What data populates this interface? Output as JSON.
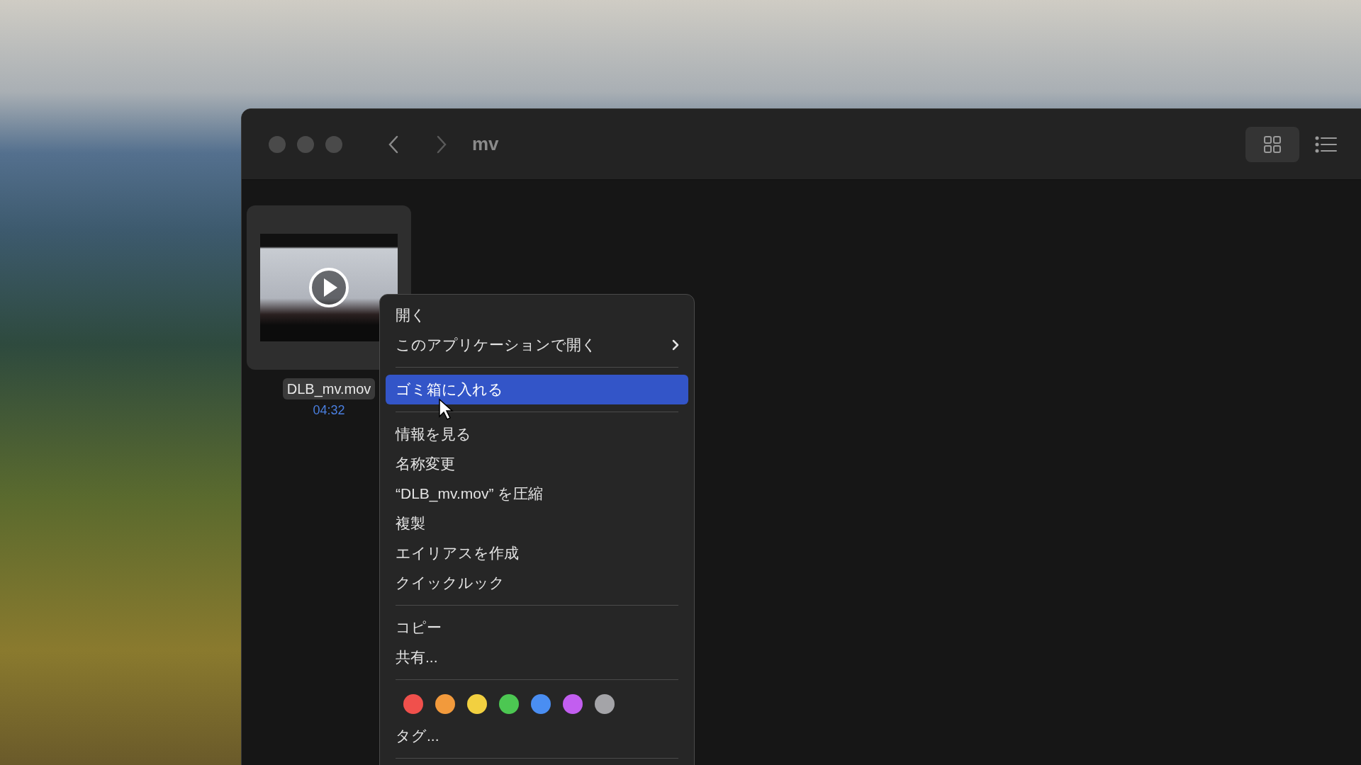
{
  "window": {
    "title": "mv",
    "view_buttons": [
      {
        "kind": "grid",
        "selected": true
      },
      {
        "kind": "list",
        "selected": false
      }
    ]
  },
  "file": {
    "name": "DLB_mv.mov",
    "duration": "04:32",
    "selected": true
  },
  "menu": {
    "items": [
      {
        "kind": "item",
        "label": "開く",
        "selected": false
      },
      {
        "kind": "submenu",
        "label": "このアプリケーションで開く",
        "selected": false
      },
      {
        "kind": "separator"
      },
      {
        "kind": "item",
        "label": "ゴミ箱に入れる",
        "selected": true
      },
      {
        "kind": "separator"
      },
      {
        "kind": "item",
        "label": "情報を見る",
        "selected": false
      },
      {
        "kind": "item",
        "label": "名称変更",
        "selected": false
      },
      {
        "kind": "item",
        "label": "“DLB_mv.mov” を圧縮",
        "selected": false
      },
      {
        "kind": "item",
        "label": "複製",
        "selected": false
      },
      {
        "kind": "item",
        "label": "エイリアスを作成",
        "selected": false
      },
      {
        "kind": "item",
        "label": "クイックルック",
        "selected": false
      },
      {
        "kind": "separator"
      },
      {
        "kind": "item",
        "label": "コピー",
        "selected": false
      },
      {
        "kind": "item",
        "label": "共有...",
        "selected": false
      },
      {
        "kind": "separator"
      },
      {
        "kind": "tags",
        "colors": [
          {
            "color": "#f0504c"
          },
          {
            "color": "#f29a3c"
          },
          {
            "color": "#f2d040"
          },
          {
            "color": "#4cc752"
          },
          {
            "color": "#4a8ef2"
          },
          {
            "color": "#c25ef0"
          },
          {
            "color": "#a4a4a8"
          }
        ]
      },
      {
        "kind": "item",
        "label": "タグ...",
        "selected": false
      },
      {
        "kind": "separator"
      }
    ]
  }
}
